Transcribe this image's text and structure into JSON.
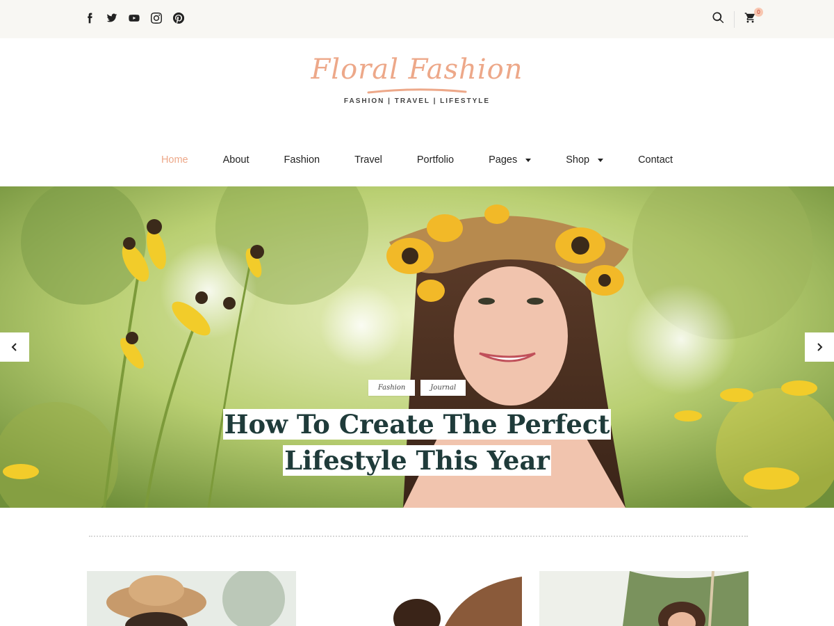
{
  "topbar": {
    "social_icons": [
      "facebook-icon",
      "twitter-icon",
      "youtube-icon",
      "instagram-icon",
      "pinterest-icon"
    ],
    "cart_count": "0"
  },
  "logo": {
    "title": "Floral Fashion",
    "tagline": "FASHION | TRAVEL | LIFESTYLE",
    "color": "#eda889"
  },
  "nav": {
    "items": [
      {
        "label": "Home",
        "active": true
      },
      {
        "label": "About"
      },
      {
        "label": "Fashion"
      },
      {
        "label": "Travel"
      },
      {
        "label": "Portfolio"
      },
      {
        "label": "Pages",
        "dropdown": true
      },
      {
        "label": "Shop",
        "dropdown": true
      },
      {
        "label": "Contact"
      }
    ]
  },
  "hero": {
    "tags": [
      "Fashion",
      "Journal"
    ],
    "title_line1": "How To Create The Perfect",
    "title_line2": "Lifestyle This Year"
  }
}
